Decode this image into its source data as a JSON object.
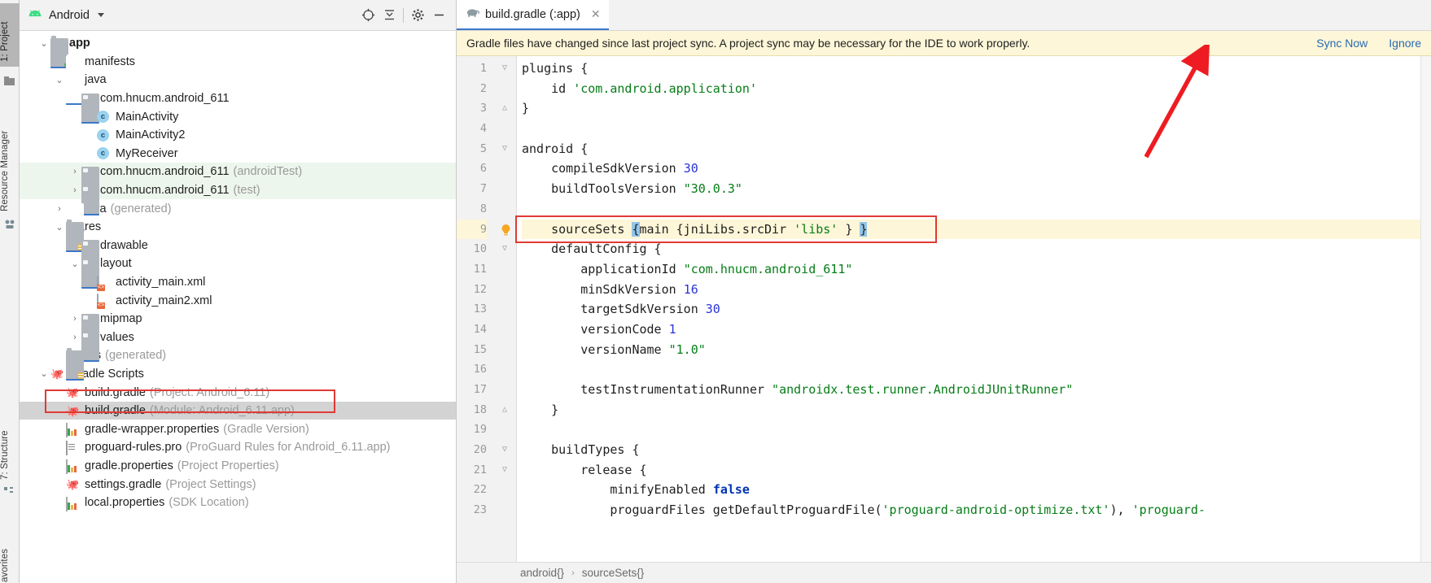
{
  "toolstrip": {
    "items": [
      {
        "label": "1: Project",
        "active": true,
        "icon": "project-icon"
      },
      {
        "label": "Resource Manager",
        "active": false,
        "icon": "resource-manager-icon"
      },
      {
        "label": "7: Structure",
        "active": false,
        "icon": "structure-icon"
      },
      {
        "label": "avorites",
        "active": false,
        "icon": "favorites-icon"
      }
    ]
  },
  "project_panel": {
    "title": "Android",
    "toolbar": [
      {
        "name": "locate-icon",
        "glyph": "⊕"
      },
      {
        "name": "collapse-all-icon",
        "glyph": "⋜"
      },
      {
        "name": "settings-gear-icon",
        "glyph": "⚙"
      },
      {
        "name": "minimize-icon",
        "glyph": "—"
      }
    ],
    "tree": [
      {
        "indent": 0,
        "twist": "v",
        "icon": "folder-module-icon",
        "label": "app",
        "dim": "",
        "bold": true,
        "style": "none"
      },
      {
        "indent": 1,
        "twist": ">",
        "icon": "folder-blue-icon",
        "label": "manifests",
        "dim": "",
        "bold": false,
        "style": "none"
      },
      {
        "indent": 1,
        "twist": "v",
        "icon": "folder-blue-icon",
        "label": "java",
        "dim": "",
        "bold": false,
        "style": "none"
      },
      {
        "indent": 2,
        "twist": "v",
        "icon": "package-icon",
        "label": "com.hnucm.android_611",
        "dim": "",
        "bold": false,
        "style": "none"
      },
      {
        "indent": 3,
        "twist": "",
        "icon": "java-class-icon",
        "label": "MainActivity",
        "dim": "",
        "bold": false,
        "style": "none"
      },
      {
        "indent": 3,
        "twist": "",
        "icon": "java-class-icon",
        "label": "MainActivity2",
        "dim": "",
        "bold": false,
        "style": "none"
      },
      {
        "indent": 3,
        "twist": "",
        "icon": "java-class-icon",
        "label": "MyReceiver",
        "dim": "",
        "bold": false,
        "style": "none"
      },
      {
        "indent": 2,
        "twist": ">",
        "icon": "package-icon",
        "label": "com.hnucm.android_611",
        "dim": "(androidTest)",
        "bold": false,
        "style": "green"
      },
      {
        "indent": 2,
        "twist": ">",
        "icon": "package-icon",
        "label": "com.hnucm.android_611",
        "dim": "(test)",
        "bold": false,
        "style": "green"
      },
      {
        "indent": 1,
        "twist": ">",
        "icon": "folder-generated-icon",
        "label": "java",
        "dim": "(generated)",
        "bold": false,
        "style": "none"
      },
      {
        "indent": 1,
        "twist": "v",
        "icon": "folder-res-icon",
        "label": "res",
        "dim": "",
        "bold": false,
        "style": "none"
      },
      {
        "indent": 2,
        "twist": ">",
        "icon": "package-icon",
        "label": "drawable",
        "dim": "",
        "bold": false,
        "style": "none"
      },
      {
        "indent": 2,
        "twist": "v",
        "icon": "package-icon",
        "label": "layout",
        "dim": "",
        "bold": false,
        "style": "none"
      },
      {
        "indent": 3,
        "twist": "",
        "icon": "xml-layout-icon",
        "label": "activity_main.xml",
        "dim": "",
        "bold": false,
        "style": "none"
      },
      {
        "indent": 3,
        "twist": "",
        "icon": "xml-layout-icon",
        "label": "activity_main2.xml",
        "dim": "",
        "bold": false,
        "style": "none"
      },
      {
        "indent": 2,
        "twist": ">",
        "icon": "package-icon",
        "label": "mipmap",
        "dim": "",
        "bold": false,
        "style": "none"
      },
      {
        "indent": 2,
        "twist": ">",
        "icon": "package-icon",
        "label": "values",
        "dim": "",
        "bold": false,
        "style": "none"
      },
      {
        "indent": 1,
        "twist": "",
        "icon": "folder-res-icon",
        "label": "res",
        "dim": "(generated)",
        "bold": false,
        "style": "none"
      },
      {
        "indent": 0,
        "twist": "v",
        "icon": "gradle-elephant-icon",
        "label": "Gradle Scripts",
        "dim": "",
        "bold": false,
        "style": "none"
      },
      {
        "indent": 1,
        "twist": "",
        "icon": "gradle-elephant-icon",
        "label": "build.gradle",
        "dim": "(Project: Android_6.11)",
        "bold": false,
        "style": "none"
      },
      {
        "indent": 1,
        "twist": "",
        "icon": "gradle-elephant-icon",
        "label": "build.gradle",
        "dim": "(Module: Android_6.11.app)",
        "bold": false,
        "style": "sel"
      },
      {
        "indent": 1,
        "twist": "",
        "icon": "properties-icon",
        "label": "gradle-wrapper.properties",
        "dim": "(Gradle Version)",
        "bold": false,
        "style": "none"
      },
      {
        "indent": 1,
        "twist": "",
        "icon": "proguard-icon",
        "label": "proguard-rules.pro",
        "dim": "(ProGuard Rules for Android_6.11.app)",
        "bold": false,
        "style": "none"
      },
      {
        "indent": 1,
        "twist": "",
        "icon": "properties-icon",
        "label": "gradle.properties",
        "dim": "(Project Properties)",
        "bold": false,
        "style": "none"
      },
      {
        "indent": 1,
        "twist": "",
        "icon": "gradle-elephant-icon",
        "label": "settings.gradle",
        "dim": "(Project Settings)",
        "bold": false,
        "style": "none"
      },
      {
        "indent": 1,
        "twist": "",
        "icon": "properties-icon",
        "label": "local.properties",
        "dim": "(SDK Location)",
        "bold": false,
        "style": "none"
      }
    ]
  },
  "editor": {
    "tab": {
      "label": "build.gradle (:app)",
      "close_glyph": "✕",
      "icon": "gradle-elephant-icon"
    },
    "notification": {
      "message": "Gradle files have changed since last project sync. A project sync may be necessary for the IDE to work properly.",
      "sync_label": "Sync Now",
      "ignore_label": "Ignore"
    },
    "lines": [
      {
        "n": "1",
        "fold": "v",
        "bulb": false,
        "hl": false,
        "tokens": [
          {
            "t": "plugins {",
            "c": ""
          }
        ]
      },
      {
        "n": "2",
        "fold": "",
        "bulb": false,
        "hl": false,
        "tokens": [
          {
            "t": "    id ",
            "c": ""
          },
          {
            "t": "'com.android.application'",
            "c": "str"
          }
        ]
      },
      {
        "n": "3",
        "fold": "^",
        "bulb": false,
        "hl": false,
        "tokens": [
          {
            "t": "}",
            "c": ""
          }
        ]
      },
      {
        "n": "4",
        "fold": "",
        "bulb": false,
        "hl": false,
        "tokens": [
          {
            "t": "",
            "c": ""
          }
        ]
      },
      {
        "n": "5",
        "fold": "v",
        "bulb": false,
        "hl": false,
        "tokens": [
          {
            "t": "android {",
            "c": ""
          }
        ]
      },
      {
        "n": "6",
        "fold": "",
        "bulb": false,
        "hl": false,
        "tokens": [
          {
            "t": "    compileSdkVersion ",
            "c": ""
          },
          {
            "t": "30",
            "c": "num"
          }
        ]
      },
      {
        "n": "7",
        "fold": "",
        "bulb": false,
        "hl": false,
        "tokens": [
          {
            "t": "    buildToolsVersion ",
            "c": ""
          },
          {
            "t": "\"30.0.3\"",
            "c": "str"
          }
        ]
      },
      {
        "n": "8",
        "fold": "",
        "bulb": false,
        "hl": false,
        "tokens": [
          {
            "t": "",
            "c": ""
          }
        ]
      },
      {
        "n": "9",
        "fold": "",
        "bulb": true,
        "hl": true,
        "tokens": [
          {
            "t": "    sourceSets ",
            "c": ""
          },
          {
            "t": "{",
            "c": "brk"
          },
          {
            "t": "main {jniLibs.srcDir ",
            "c": ""
          },
          {
            "t": "'libs'",
            "c": "str"
          },
          {
            "t": " } ",
            "c": ""
          },
          {
            "t": "}",
            "c": "brk"
          }
        ]
      },
      {
        "n": "10",
        "fold": "v",
        "bulb": false,
        "hl": false,
        "tokens": [
          {
            "t": "    defaultConfig {",
            "c": ""
          }
        ]
      },
      {
        "n": "11",
        "fold": "",
        "bulb": false,
        "hl": false,
        "tokens": [
          {
            "t": "        applicationId ",
            "c": ""
          },
          {
            "t": "\"com.hnucm.android_611\"",
            "c": "str"
          }
        ]
      },
      {
        "n": "12",
        "fold": "",
        "bulb": false,
        "hl": false,
        "tokens": [
          {
            "t": "        minSdkVersion ",
            "c": ""
          },
          {
            "t": "16",
            "c": "num"
          }
        ]
      },
      {
        "n": "13",
        "fold": "",
        "bulb": false,
        "hl": false,
        "tokens": [
          {
            "t": "        targetSdkVersion ",
            "c": ""
          },
          {
            "t": "30",
            "c": "num"
          }
        ]
      },
      {
        "n": "14",
        "fold": "",
        "bulb": false,
        "hl": false,
        "tokens": [
          {
            "t": "        versionCode ",
            "c": ""
          },
          {
            "t": "1",
            "c": "num"
          }
        ]
      },
      {
        "n": "15",
        "fold": "",
        "bulb": false,
        "hl": false,
        "tokens": [
          {
            "t": "        versionName ",
            "c": ""
          },
          {
            "t": "\"1.0\"",
            "c": "str"
          }
        ]
      },
      {
        "n": "16",
        "fold": "",
        "bulb": false,
        "hl": false,
        "tokens": [
          {
            "t": "",
            "c": ""
          }
        ]
      },
      {
        "n": "17",
        "fold": "",
        "bulb": false,
        "hl": false,
        "tokens": [
          {
            "t": "        testInstrumentationRunner ",
            "c": ""
          },
          {
            "t": "\"androidx.test.runner.AndroidJUnitRunner\"",
            "c": "str"
          }
        ]
      },
      {
        "n": "18",
        "fold": "^",
        "bulb": false,
        "hl": false,
        "tokens": [
          {
            "t": "    }",
            "c": ""
          }
        ]
      },
      {
        "n": "19",
        "fold": "",
        "bulb": false,
        "hl": false,
        "tokens": [
          {
            "t": "",
            "c": ""
          }
        ]
      },
      {
        "n": "20",
        "fold": "v",
        "bulb": false,
        "hl": false,
        "tokens": [
          {
            "t": "    buildTypes {",
            "c": ""
          }
        ]
      },
      {
        "n": "21",
        "fold": "v",
        "bulb": false,
        "hl": false,
        "tokens": [
          {
            "t": "        release {",
            "c": ""
          }
        ]
      },
      {
        "n": "22",
        "fold": "",
        "bulb": false,
        "hl": false,
        "tokens": [
          {
            "t": "            minifyEnabled ",
            "c": ""
          },
          {
            "t": "false",
            "c": "kw"
          }
        ]
      },
      {
        "n": "23",
        "fold": "",
        "bulb": false,
        "hl": false,
        "tokens": [
          {
            "t": "            proguardFiles getDefaultProguardFile(",
            "c": ""
          },
          {
            "t": "'proguard-android-optimize.txt'",
            "c": "str"
          },
          {
            "t": "), ",
            "c": ""
          },
          {
            "t": "'proguard-",
            "c": "str"
          }
        ]
      }
    ],
    "breadcrumb": [
      "android{}",
      "sourceSets{}"
    ],
    "breadcrumb_sep": "›"
  },
  "colors": {
    "accent_blue": "#2a6ab0",
    "annotation_red": "#e03a34",
    "string_green": "#067d17",
    "number_blue": "#2a34d4",
    "keyword_blue": "#0033b3",
    "notify_bg": "#fdf6d8",
    "selection_gray": "#d3d3d3",
    "test_row_green": "#edf6ed",
    "bracket_highlight": "#93c5e8"
  }
}
